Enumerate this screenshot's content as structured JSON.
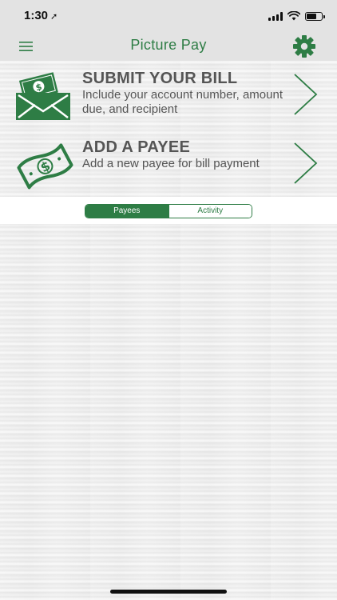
{
  "status_bar": {
    "time": "1:30",
    "location_glyph": "➚"
  },
  "nav": {
    "title": "Picture Pay",
    "menu_icon": "hamburger-icon",
    "settings_icon": "gear-icon"
  },
  "actions": [
    {
      "title": "SUBMIT YOUR BILL",
      "subtitle": "Include your account number, amount due, and recipient",
      "icon": "bill-envelope-icon"
    },
    {
      "title": "ADD A PAYEE",
      "subtitle": "Add a new payee for bill payment",
      "icon": "dollar-bill-icon"
    }
  ],
  "tabs": [
    {
      "label": "Payees",
      "selected": true
    },
    {
      "label": "Activity",
      "selected": false
    }
  ],
  "colors": {
    "brand_green": "#2e7d45",
    "text_gray": "#555555"
  }
}
